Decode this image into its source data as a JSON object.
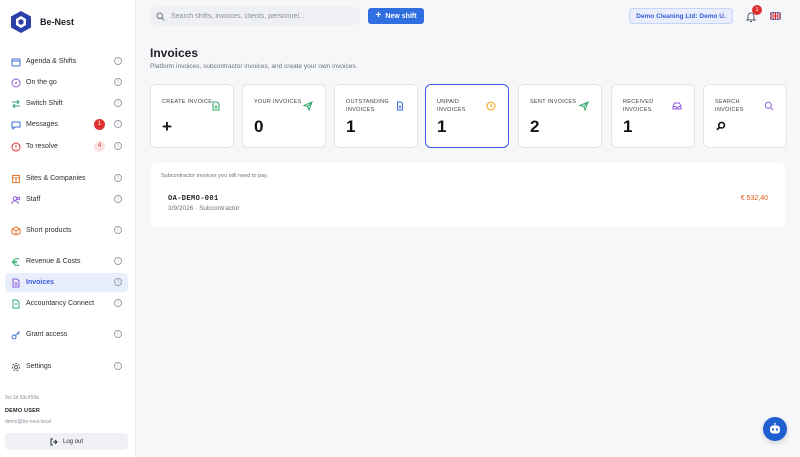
{
  "app": {
    "name": "Be-Nest"
  },
  "colors": {
    "accent": "#2f6fe0",
    "active_text": "#3b5bdb",
    "danger": "#e03131",
    "amount": "#e8590c"
  },
  "sidebar": {
    "items": [
      {
        "label": "Agenda & Shifts",
        "icon": "calendar-icon"
      },
      {
        "label": "On the go",
        "icon": "compass-icon"
      },
      {
        "label": "Switch Shift",
        "icon": "swap-icon"
      },
      {
        "label": "Messages",
        "icon": "message-icon",
        "badge": "1"
      },
      {
        "label": "To resolve",
        "icon": "alert-icon",
        "badge": "4"
      },
      {
        "label": "Sites & Companies",
        "icon": "building-icon"
      },
      {
        "label": "Staff",
        "icon": "users-icon"
      },
      {
        "label": "Short products",
        "icon": "box-icon"
      },
      {
        "label": "Revenue & Costs",
        "icon": "euro-icon"
      },
      {
        "label": "Invoices",
        "icon": "file-icon",
        "active": true
      },
      {
        "label": "Accountancy Connect",
        "icon": "document-icon"
      },
      {
        "label": "Grant access",
        "icon": "key-icon"
      },
      {
        "label": "Settings",
        "icon": "gear-icon"
      }
    ],
    "build_hash": "9cc1d  93c459a",
    "user_name": "DEMO USER",
    "user_email": "demo@be-nest.local",
    "logout_label": "Log out"
  },
  "topbar": {
    "search_placeholder": "Search shifts, invoices, clients, personnel...",
    "new_shift_label": "New shift",
    "company_label": "Demo Cleaning Ltd: Demo U.",
    "notifications_count": "1"
  },
  "page": {
    "title": "Invoices",
    "subtitle": "Platform invoices, subcontractor invoices, and create your own invoices."
  },
  "cards": [
    {
      "label": "CREATE INVOICE",
      "value": "+",
      "icon": "file-plus-icon"
    },
    {
      "label": "YOUR INVOICES",
      "value": "0",
      "icon": "send-icon"
    },
    {
      "label": "OUTSTANDING INVOICES",
      "value": "1",
      "icon": "document-icon"
    },
    {
      "label": "UNPAID INVOICES",
      "value": "1",
      "icon": "clock-icon",
      "selected": true
    },
    {
      "label": "SENT INVOICES",
      "value": "2",
      "icon": "send-icon"
    },
    {
      "label": "RECEIVED INVOICES",
      "value": "1",
      "icon": "inbox-icon"
    },
    {
      "label": "SEARCH INVOICES",
      "value": "",
      "icon": "search-icon"
    }
  ],
  "panel": {
    "note": "Subcontractor invoices you still need to pay.",
    "rows": [
      {
        "number": "OA-DEMO-001",
        "meta": "3/9/2026 · Subcontractor",
        "amount": "€ 532,40"
      }
    ]
  }
}
